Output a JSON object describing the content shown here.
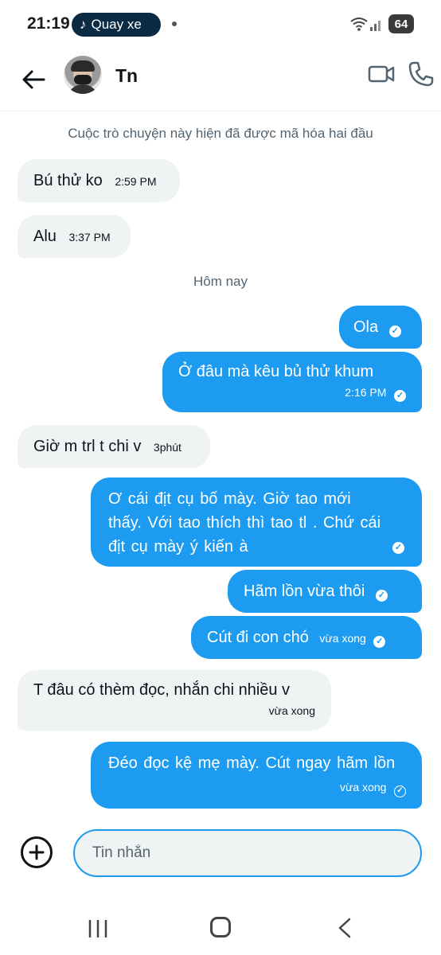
{
  "status_bar": {
    "time": "21:19",
    "recording_label": "Quay xe",
    "battery": "64"
  },
  "header": {
    "contact_name": "Tn"
  },
  "encryption_note": "Cuộc trò chuyện này hiện đã được mã hóa hai đầu",
  "date_separator": "Hôm nay",
  "messages": [
    {
      "dir": "in",
      "text": "Bú thử ko",
      "time": "2:59 PM"
    },
    {
      "dir": "in",
      "text": "Alu",
      "time": "3:37 PM"
    },
    {
      "dir": "out",
      "text": "Ola",
      "time": ""
    },
    {
      "dir": "out",
      "text": "Ở đâu mà kêu bủ thử khum",
      "time": "2:16 PM"
    },
    {
      "dir": "in",
      "text": "Giờ m trl t chi v",
      "time": "3phút"
    },
    {
      "dir": "out",
      "text": "Ơ cái địt cụ bố mày. Giờ tao mới thấy. Với tao thích thì tao tl . Chứ cái địt cụ mày ý kiến à",
      "time": ""
    },
    {
      "dir": "out",
      "text": "Hãm lồn vừa thôi",
      "time": ""
    },
    {
      "dir": "out",
      "text": "Cút đi con chó",
      "time": "vừa xong"
    },
    {
      "dir": "in",
      "text": "T đâu có thèm đọc, nhắn chi nhiều v",
      "time": "vừa xong"
    },
    {
      "dir": "out",
      "text": "Đéo đọc kệ mẹ mày. Cút ngay hãm lồn",
      "time": "vừa xong"
    }
  ],
  "composer": {
    "placeholder": "Tin nhắn"
  },
  "colors": {
    "accent": "#1d9bf0",
    "incoming_bubble": "#eff3f4",
    "secondary_text": "#536471"
  },
  "icons": {
    "back": "arrow-left-icon",
    "video": "video-camera-icon",
    "call": "phone-icon",
    "add": "plus-circle-icon",
    "read": "check-circle-icon"
  }
}
